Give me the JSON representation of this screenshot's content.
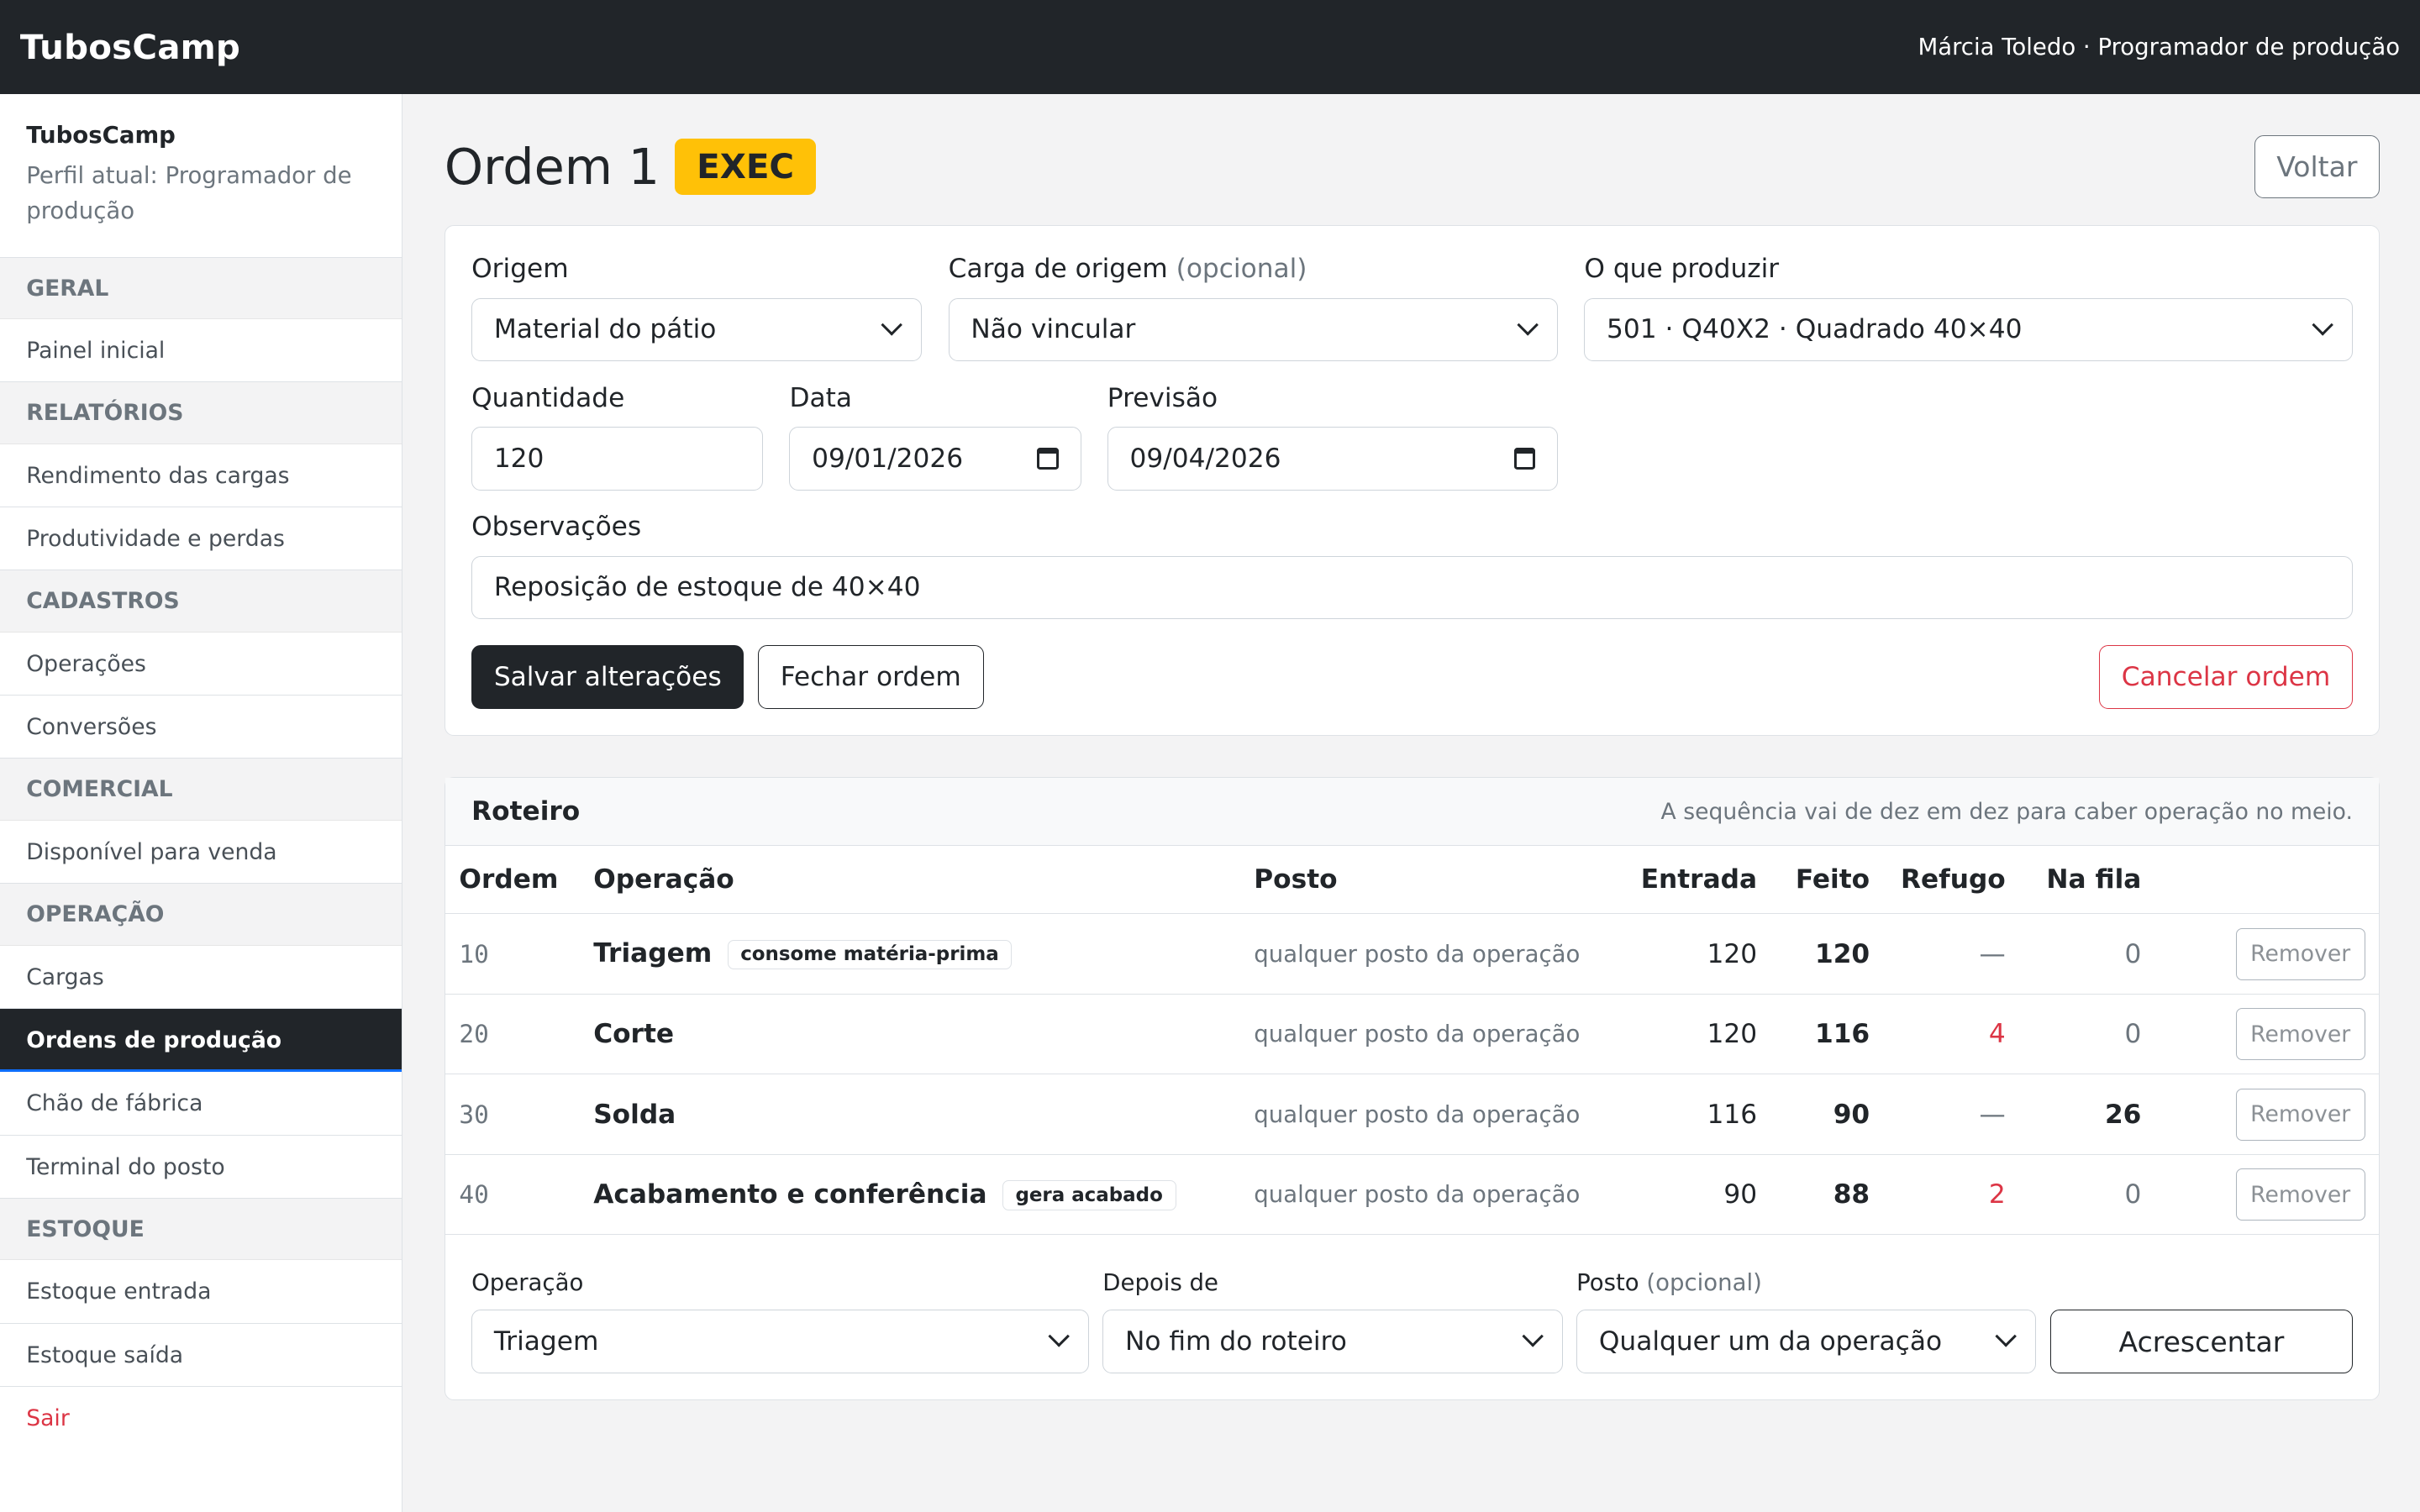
{
  "topbar": {
    "brand": "TubosCamp",
    "user": "Márcia Toledo · Programador de produção"
  },
  "sidebar": {
    "title": "TubosCamp",
    "profile": "Perfil atual: Programador de produção",
    "sections": [
      {
        "label": "GERAL",
        "items": [
          "Painel inicial"
        ]
      },
      {
        "label": "RELATÓRIOS",
        "items": [
          "Rendimento das cargas",
          "Produtividade e perdas"
        ]
      },
      {
        "label": "CADASTROS",
        "items": [
          "Operações",
          "Conversões"
        ]
      },
      {
        "label": "COMERCIAL",
        "items": [
          "Disponível para venda"
        ]
      },
      {
        "label": "OPERAÇÃO",
        "items": [
          "Cargas",
          "Ordens de produção",
          "Chão de fábrica",
          "Terminal do posto"
        ]
      },
      {
        "label": "ESTOQUE",
        "items": [
          "Estoque entrada",
          "Estoque saída"
        ]
      }
    ],
    "logout": "Sair"
  },
  "page": {
    "title": "Ordem 1",
    "status": "EXEC",
    "back_label": "Voltar"
  },
  "form": {
    "origem": {
      "label": "Origem",
      "value": "Material do pátio"
    },
    "carga": {
      "label": "Carga de origem",
      "optional": "(opcional)",
      "value": "Não vincular"
    },
    "produzir": {
      "label": "O que produzir",
      "value": "501 · Q40X2 · Quadrado 40×40"
    },
    "quantidade": {
      "label": "Quantidade",
      "value": "120"
    },
    "data": {
      "label": "Data",
      "value": "09/01/2026"
    },
    "previsao": {
      "label": "Previsão",
      "value": "09/04/2026"
    },
    "observacoes": {
      "label": "Observações",
      "value": "Reposição de estoque de 40×40"
    },
    "save_label": "Salvar alterações",
    "close_label": "Fechar ordem",
    "cancel_label": "Cancelar ordem"
  },
  "roteiro": {
    "title": "Roteiro",
    "hint": "A sequência vai de dez em dez para caber operação no meio.",
    "columns": {
      "ordem": "Ordem",
      "operacao": "Operação",
      "posto": "Posto",
      "entrada": "Entrada",
      "feito": "Feito",
      "refugo": "Refugo",
      "fila": "Na fila"
    },
    "remove_label": "Remover",
    "rows": [
      {
        "seq": "10",
        "op": "Triagem",
        "tag": "consome matéria-prima",
        "posto": "qualquer posto da operação",
        "entrada": "120",
        "feito": "120",
        "refugo": "—",
        "fila": "0"
      },
      {
        "seq": "20",
        "op": "Corte",
        "tag": "",
        "posto": "qualquer posto da operação",
        "entrada": "120",
        "feito": "116",
        "refugo": "4",
        "fila": "0"
      },
      {
        "seq": "30",
        "op": "Solda",
        "tag": "",
        "posto": "qualquer posto da operação",
        "entrada": "116",
        "feito": "90",
        "refugo": "—",
        "fila": "26"
      },
      {
        "seq": "40",
        "op": "Acabamento e conferência",
        "tag": "gera acabado",
        "posto": "qualquer posto da operação",
        "entrada": "90",
        "feito": "88",
        "refugo": "2",
        "fila": "0"
      }
    ],
    "add": {
      "operacao": {
        "label": "Operação",
        "value": "Triagem"
      },
      "depois": {
        "label": "Depois de",
        "value": "No fim do roteiro"
      },
      "posto": {
        "label": "Posto",
        "optional": "(opcional)",
        "value": "Qualquer um da operação"
      },
      "add_label": "Acrescentar"
    }
  },
  "colors": {
    "accent": "#ffc107",
    "dark": "#212529",
    "danger": "#dc3545"
  }
}
